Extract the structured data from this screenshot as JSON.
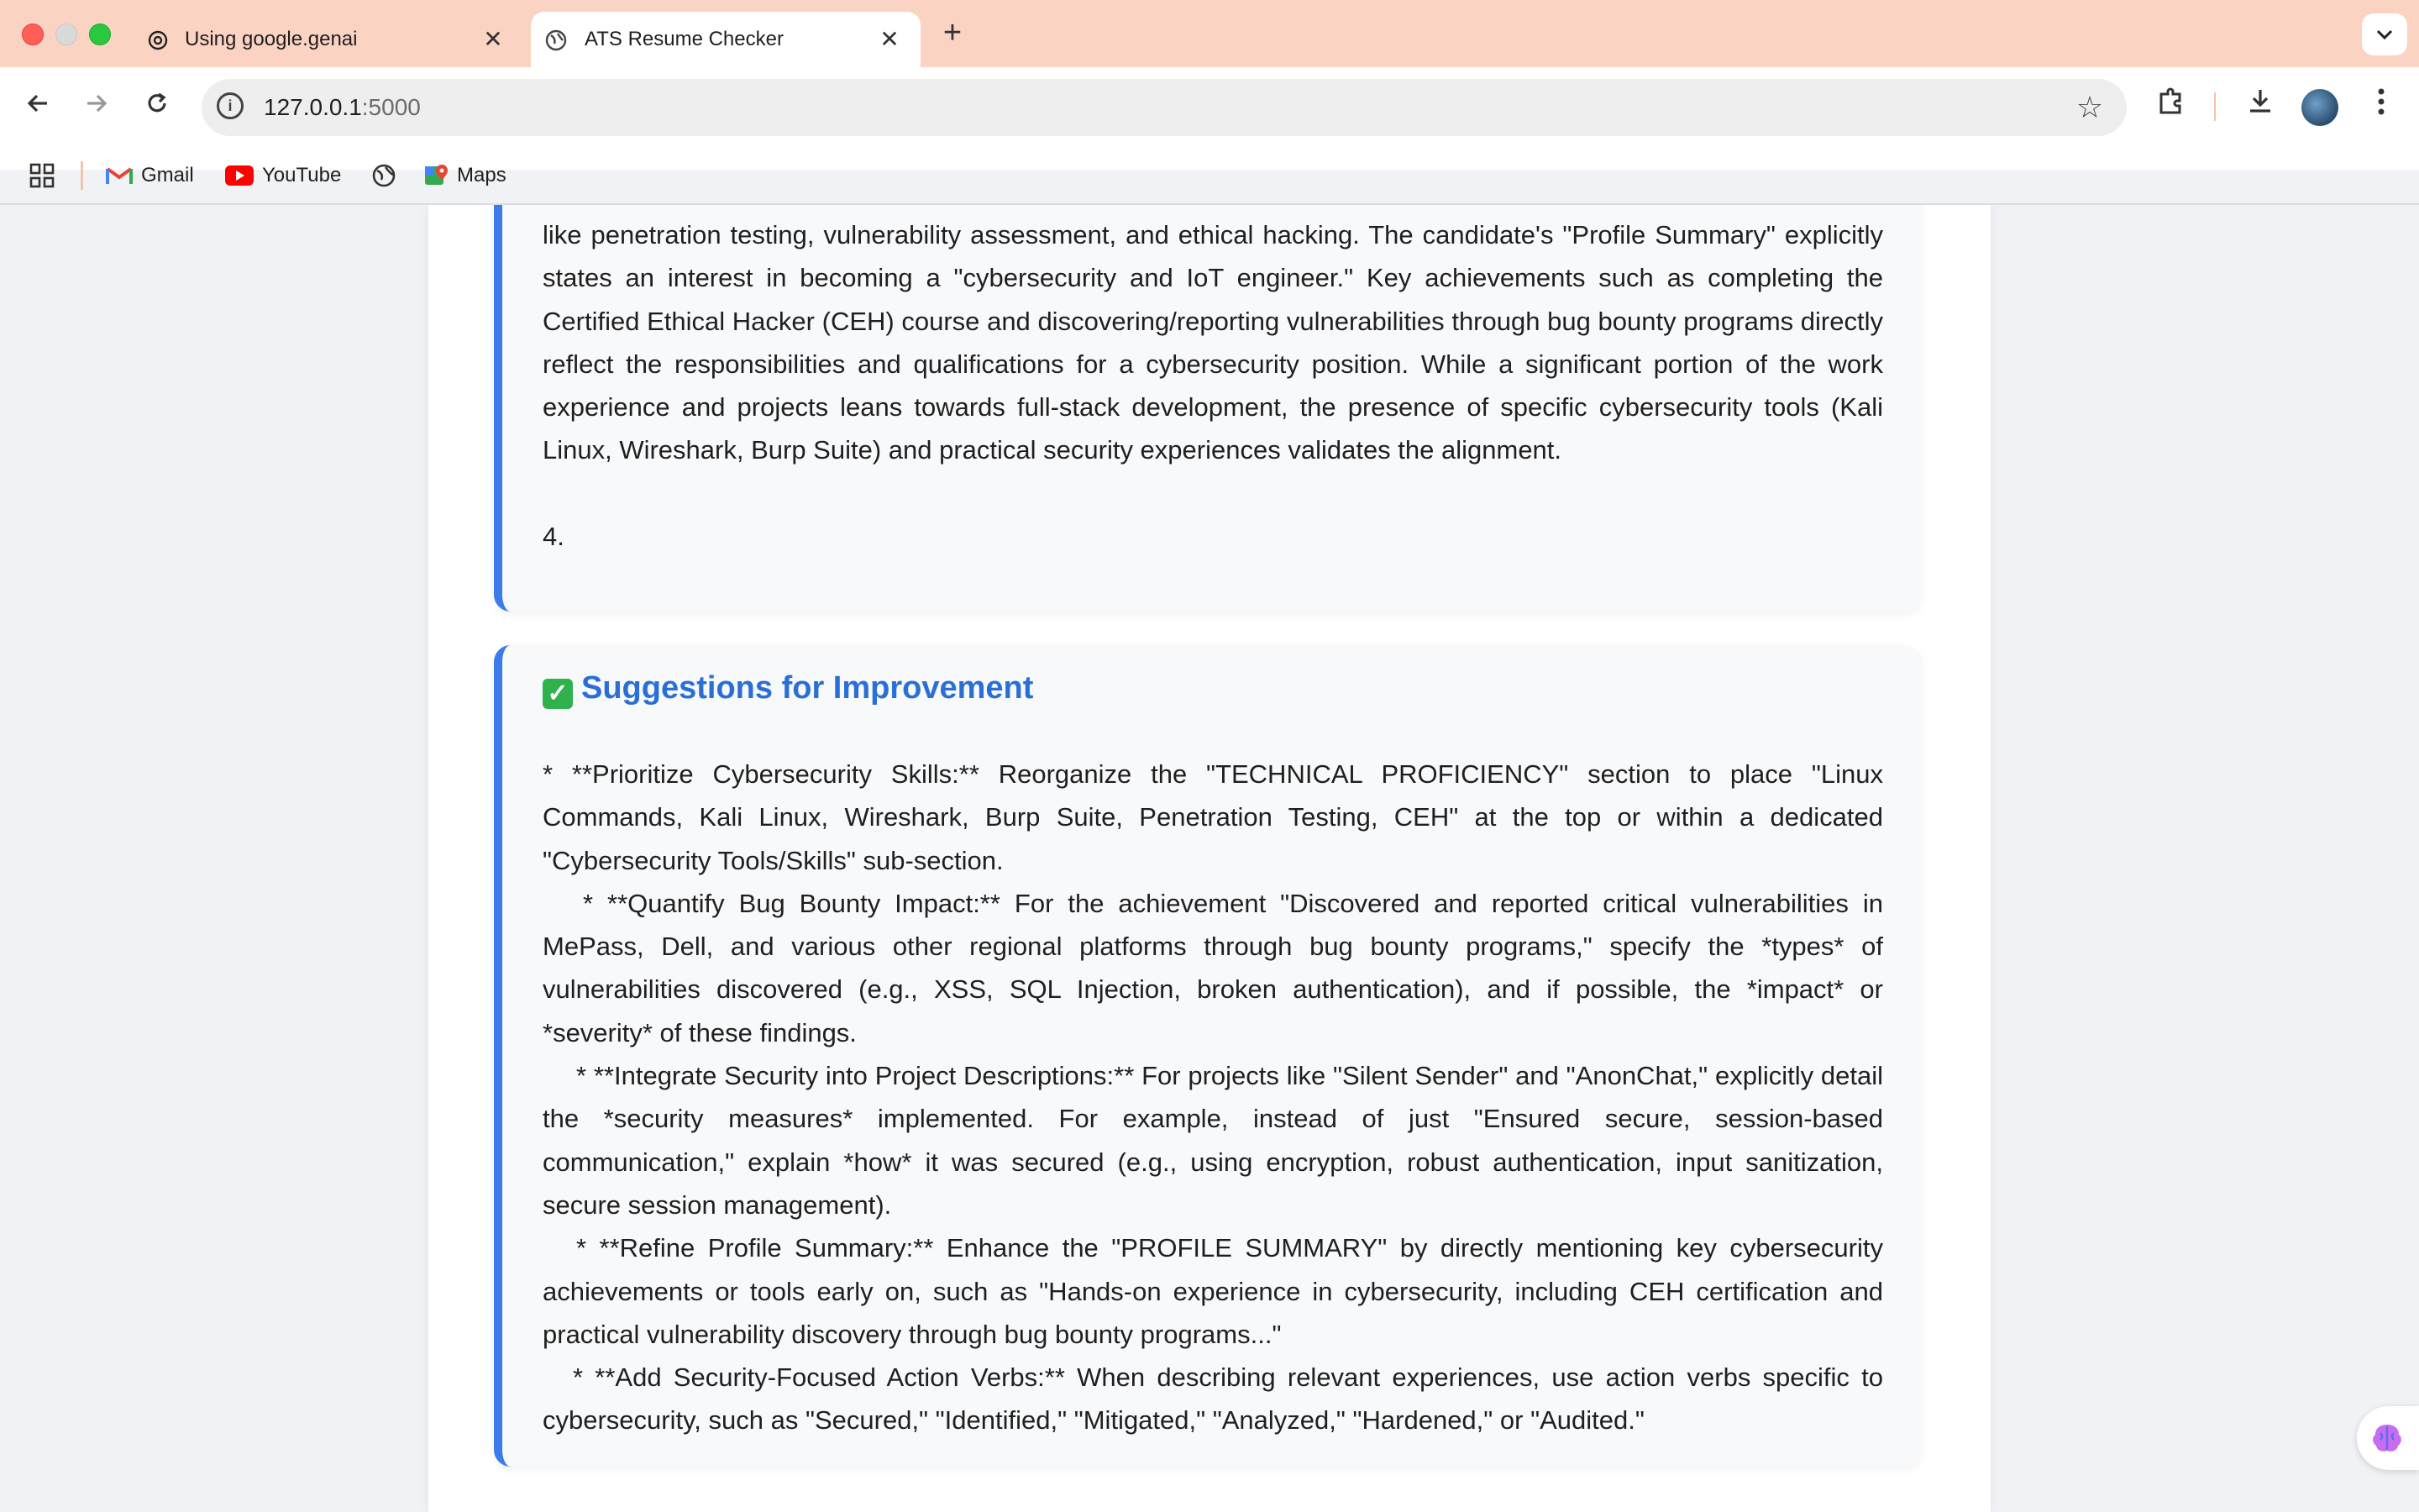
{
  "tabs": [
    {
      "title": "Using google.genai",
      "active": false
    },
    {
      "title": "ATS Resume Checker",
      "active": true
    }
  ],
  "address_bar": {
    "host": "127.0.0.1",
    "port": ":5000"
  },
  "bookmarks": [
    {
      "label": "Gmail"
    },
    {
      "label": "YouTube"
    },
    {
      "label": ""
    },
    {
      "label": "Maps"
    }
  ],
  "alignment_section": {
    "paragraph": "like penetration testing, vulnerability assessment, and ethical hacking. The candidate's \"Profile Summary\" explicitly states an interest in becoming a \"cybersecurity and IoT engineer.\" Key achievements such as completing the Certified Ethical Hacker (CEH) course and discovering/reporting vulnerabilities through bug bounty programs directly reflect the responsibilities and qualifications for a cybersecurity position. While a significant portion of the work experience and projects leans towards full-stack development, the presence of specific cybersecurity tools (Kali Linux, Wireshark, Burp Suite) and practical security experiences validates the alignment.",
    "trailing_number": "4."
  },
  "suggestions_section": {
    "title": "Suggestions for Improvement",
    "items": [
      "*    **Prioritize Cybersecurity Skills:** Reorganize the \"TECHNICAL PROFICIENCY\" section to place \"Linux Commands, Kali Linux, Wireshark, Burp Suite, Penetration Testing, CEH\" at the top or within a dedicated \"Cybersecurity Tools/Skills\" sub-section.",
      "*    **Quantify Bug Bounty Impact:** For the achievement \"Discovered and reported critical vulnerabilities in MePass, Dell, and various other regional platforms through bug bounty programs,\" specify the *types* of vulnerabilities discovered (e.g., XSS, SQL Injection, broken authentication), and if possible, the *impact* or *severity* of these findings.",
      "*    **Integrate Security into Project Descriptions:** For projects like \"Silent Sender\" and \"AnonChat,\" explicitly detail the *security measures* implemented. For example, instead of just \"Ensured secure, session-based communication,\" explain *how* it was secured (e.g., using encryption, robust authentication, input sanitization, secure session management).",
      "*    **Refine Profile Summary:** Enhance the \"PROFILE SUMMARY\" by directly mentioning key cybersecurity achievements or tools early on, such as \"Hands-on experience in cybersecurity, including CEH certification and practical vulnerability discovery through bug bounty programs...\"",
      "*    **Add Security-Focused Action Verbs:** When describing relevant experiences, use action verbs specific to cybersecurity, such as \"Secured,\" \"Identified,\" \"Mitigated,\" \"Analyzed,\" \"Hardened,\" or \"Audited.\""
    ]
  },
  "colors": {
    "tabstrip": "#fbd3c2",
    "accent_border": "#3b7bea",
    "title_blue": "#2a6fd6"
  }
}
